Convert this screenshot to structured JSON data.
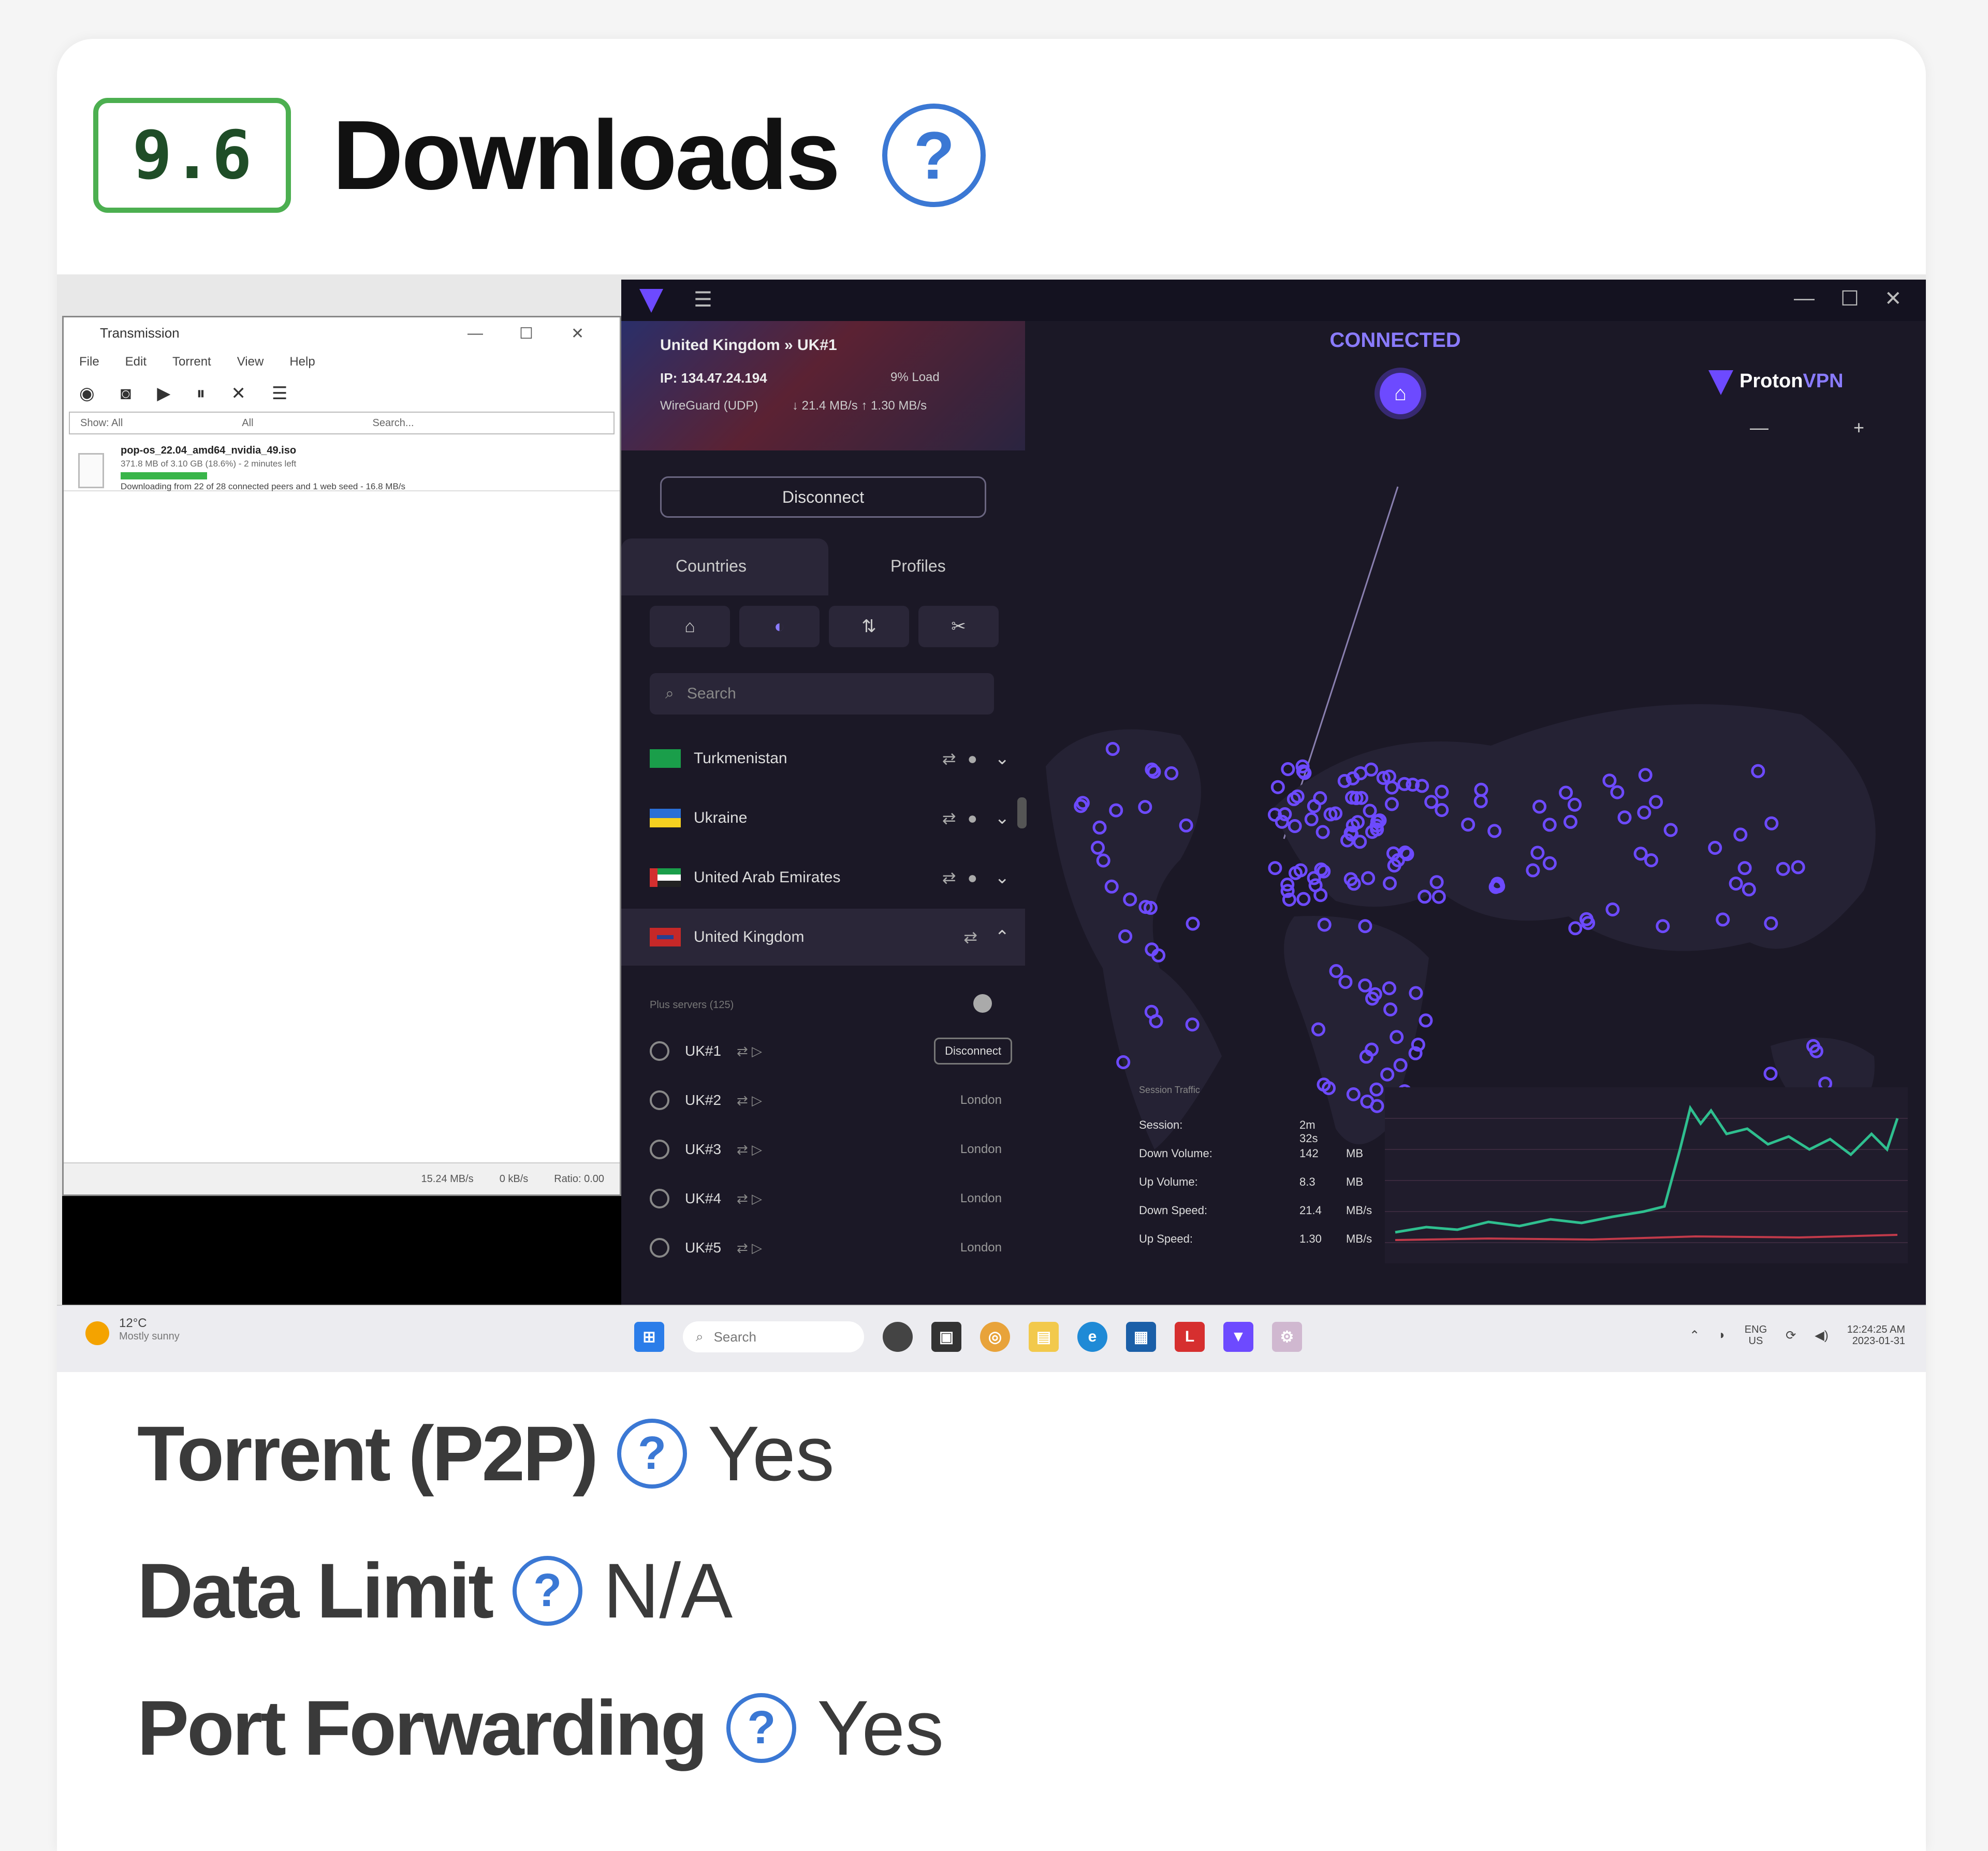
{
  "section": {
    "score": "9.6",
    "title": "Downloads",
    "help_glyph": "?"
  },
  "screenshot": {
    "transmission": {
      "title": "Transmission",
      "menu": [
        "File",
        "Edit",
        "Torrent",
        "View",
        "Help"
      ],
      "filter": {
        "show_label": "Show:",
        "status_value": "All",
        "tracker_value": "All",
        "search_placeholder": "Search..."
      },
      "torrent": {
        "name": "pop-os_22.04_amd64_nvidia_49.iso",
        "meta": "371.8 MB of 3.10 GB (18.6%) - 2 minutes left",
        "progress": 0.186,
        "status": "Downloading from 22 of 28 connected peers and 1 web seed - 16.8 MB/s"
      },
      "footer": {
        "down_speed": "15.24 MB/s",
        "up_speed": "0 kB/s",
        "ratio": "Ratio: 0.00"
      }
    },
    "proton": {
      "server": "United Kingdom » UK#1",
      "ip": "IP: 134.47.24.194",
      "load": "9% Load",
      "protocol": "WireGuard (UDP)",
      "speed": "↓ 21.4 MB/s  ↑ 1.30 MB/s",
      "disconnect_label": "Disconnect",
      "tabs": [
        "Countries",
        "Profiles"
      ],
      "search_placeholder": "Search",
      "countries": [
        {
          "name": "Turkmenistan",
          "open": false
        },
        {
          "name": "Ukraine",
          "open": false
        },
        {
          "name": "United Arab Emirates",
          "open": false
        },
        {
          "name": "United Kingdom",
          "open": true
        }
      ],
      "servers_header": "Plus servers (125)",
      "servers": [
        {
          "name": "UK#1",
          "right": "Disconnect",
          "is_button": true
        },
        {
          "name": "UK#2",
          "right": "London",
          "is_button": false
        },
        {
          "name": "UK#3",
          "right": "London",
          "is_button": false
        },
        {
          "name": "UK#4",
          "right": "London",
          "is_button": false
        },
        {
          "name": "UK#5",
          "right": "London",
          "is_button": false
        }
      ],
      "status": "CONNECTED",
      "brand": "Proton",
      "brand_accent": "VPN",
      "stats_title": "Session Traffic",
      "stats": [
        {
          "label": "Session:",
          "value": "2m 32s",
          "unit": ""
        },
        {
          "label": "Down Volume:",
          "value": "142",
          "unit": "MB"
        },
        {
          "label": "Up Volume:",
          "value": "8.3",
          "unit": "MB"
        },
        {
          "label": "Down Speed:",
          "value": "21.4",
          "unit": "MB/s"
        },
        {
          "label": "Up Speed:",
          "value": "1.30",
          "unit": "MB/s"
        }
      ],
      "colors": {
        "accent": "#6d4aff",
        "download_line": "#2fbf8f",
        "upload_line": "#c23a4a"
      }
    },
    "taskbar": {
      "weather_temp": "12°C",
      "weather_desc": "Mostly sunny",
      "search_placeholder": "Search",
      "lang": "ENG",
      "region": "US",
      "time": "12:24:25 AM",
      "date": "2023-01-31"
    }
  },
  "features": [
    {
      "label": "Torrent (P2P)",
      "value": "Yes"
    },
    {
      "label": "Data Limit",
      "value": "N/A"
    },
    {
      "label": "Port Forwarding",
      "value": "Yes"
    }
  ]
}
